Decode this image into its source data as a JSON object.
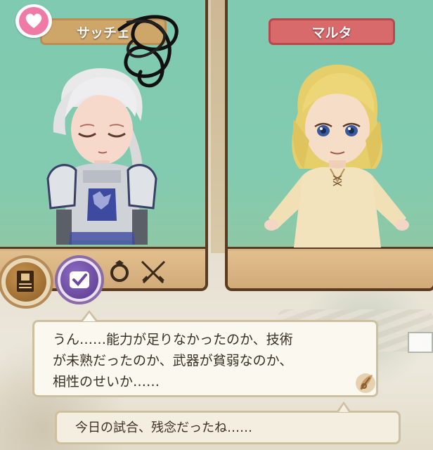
{
  "left_panel": {
    "name": "サッチェ",
    "avatar_hair_color": "#e9e9ea",
    "armor_color": "#cfd3d8"
  },
  "right_panel": {
    "name": "マルタ",
    "avatar_hair_color": "#e6cf6a",
    "clothes_color": "#f3e3bd"
  },
  "icons": {
    "favorite": "heart-icon",
    "notes": "notebook-icon",
    "check": "checkmark-icon",
    "ring": "ring-icon",
    "battle": "crossed-swords-icon",
    "next": "quill-next-icon"
  },
  "dialogue": {
    "lines": [
      "うん……能力が足りなかったのか、技術",
      "が未熟だったのか、武器が貧弱なのか、",
      "相性のせいか……"
    ],
    "reply": "今日の試合、残念だったね……"
  },
  "colors": {
    "panel_sky": "#82cbb0",
    "panel_frame": "#5a3b20",
    "left_name_plate": "#cfa66a",
    "right_name_plate": "#d86a6c",
    "heart": "#f07aa6",
    "check_button": "#6b4aa0"
  }
}
